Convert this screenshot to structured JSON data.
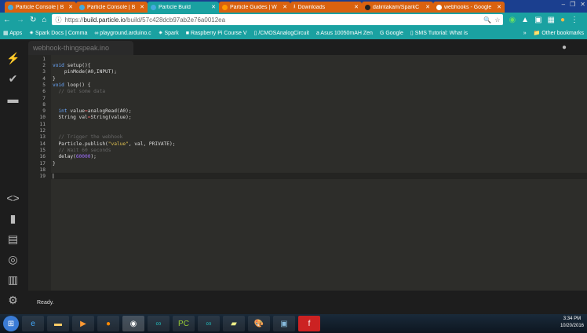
{
  "browser": {
    "tabs": [
      {
        "label": "Particle Console | B",
        "active": false
      },
      {
        "label": "Particle Console | B",
        "active": false
      },
      {
        "label": "Particle Build",
        "active": true
      },
      {
        "label": "Particle Guides | W",
        "active": false
      },
      {
        "label": "Downloads",
        "active": false
      },
      {
        "label": "dalintakam/SparkC",
        "active": false
      },
      {
        "label": "webhooks - Google",
        "active": false
      }
    ],
    "url_prefix": "https://",
    "url_domain": "build.particle.io",
    "url_path": "/build/57c428dcb97ab2e76a0012ea",
    "bookmarks": [
      "Apps",
      "Spark Docs | Comma",
      "playground.arduino.c",
      "Spark",
      "Raspberry Pi Course V",
      "/CMOSAnalogCircuit",
      "Asus 10050mAH Zen",
      "Google",
      "SMS Tutorial: What is"
    ],
    "other_bookmarks": "Other bookmarks",
    "overflow": "»"
  },
  "ide": {
    "file_tab": "webhook-thingspeak.ino",
    "status": "Ready.",
    "lines": [
      "1",
      "2",
      "3",
      "4",
      "5",
      "6",
      "7",
      "8",
      "9",
      "10",
      "11",
      "12",
      "13",
      "14",
      "15",
      "16",
      "17",
      "18",
      "19"
    ],
    "code": {
      "l2a": "void",
      "l2b": " setup(){",
      "l3": "    pinMode(A0,INPUT);",
      "l4": "}",
      "l5a": "void",
      "l5b": " loop() {",
      "l6": "  // Get some data",
      "l9a": "  int",
      "l9b": " value",
      "l9c": "=",
      "l9d": "analogRead(A0);",
      "l10a": "  String val",
      "l10b": "=",
      "l10c": "String(value);",
      "l13": "  // Trigger the webhook",
      "l14a": "  Particle.publish(",
      "l14b": "\"value\"",
      "l14c": ", val, PRIVATE);",
      "l15": "  // Wait 60 seconds",
      "l16a": "  delay(",
      "l16b": "60000",
      "l16c": ");",
      "l17": "}"
    }
  },
  "taskbar": {
    "time": "3:34 PM",
    "date": "10/20/2016"
  }
}
